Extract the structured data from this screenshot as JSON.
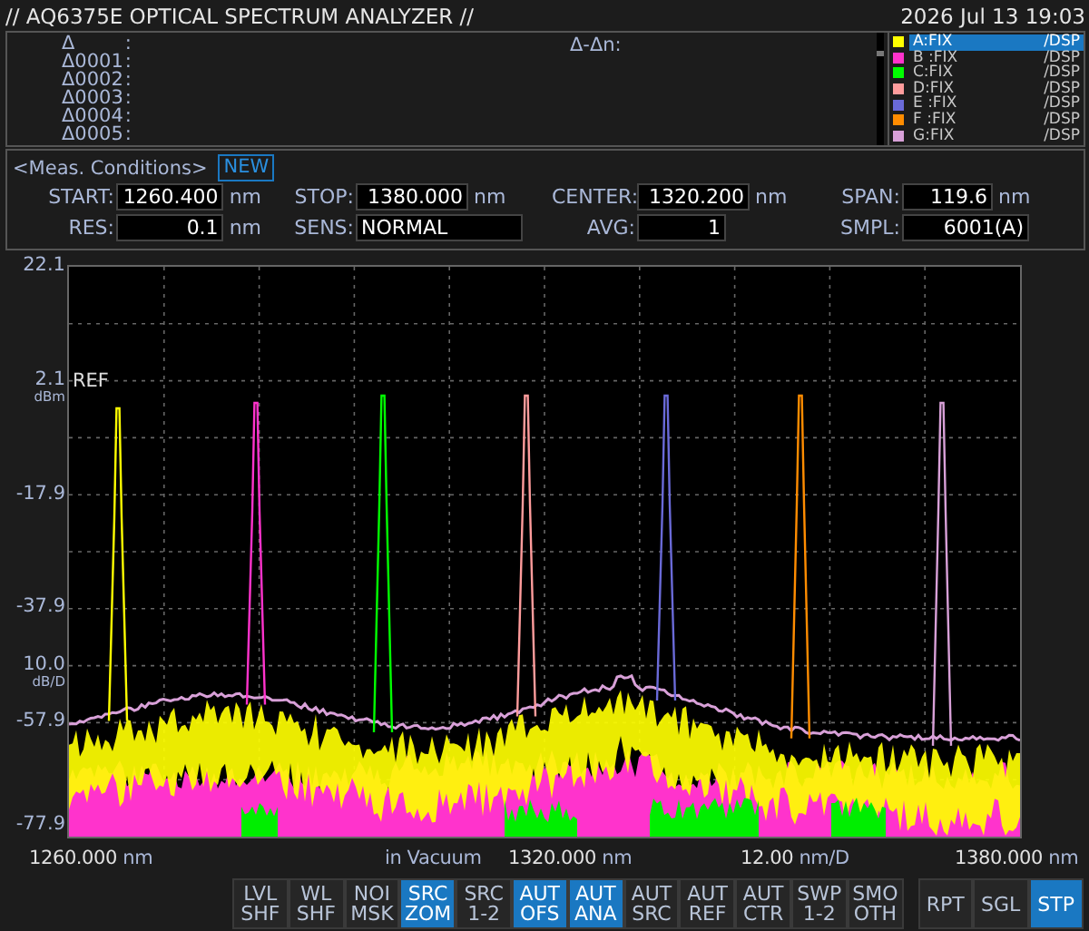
{
  "header": {
    "title": "// AQ6375E OPTICAL SPECTRUM ANALYZER //",
    "datetime": "2026 Jul 13 19:03"
  },
  "markers": {
    "rows": [
      {
        "name": "Δ",
        "sep": ":"
      },
      {
        "name": "Δ0001",
        "sep": ":"
      },
      {
        "name": "Δ0002",
        "sep": ":"
      },
      {
        "name": "Δ0003",
        "sep": ":"
      },
      {
        "name": "Δ0004",
        "sep": ":"
      },
      {
        "name": "Δ0005",
        "sep": ":"
      }
    ],
    "delta_label": "Δ-Δn:"
  },
  "traces": [
    {
      "label": "A:FIX",
      "mode": "/DSP",
      "color": "#ffff00",
      "selected": true
    },
    {
      "label": "B :FIX",
      "mode": "/DSP",
      "color": "#ff33cc",
      "selected": false
    },
    {
      "label": "C:FIX",
      "mode": "/DSP",
      "color": "#00ff00",
      "selected": false
    },
    {
      "label": "D:FIX",
      "mode": "/DSP",
      "color": "#ff9c9c",
      "selected": false
    },
    {
      "label": "E :FIX",
      "mode": "/DSP",
      "color": "#6a6ad8",
      "selected": false
    },
    {
      "label": "F :FIX",
      "mode": "/DSP",
      "color": "#ff8c00",
      "selected": false
    },
    {
      "label": "G:FIX",
      "mode": "/DSP",
      "color": "#d8a0d8",
      "selected": false
    }
  ],
  "conditions": {
    "title": "<Meas. Conditions>",
    "badge": "NEW",
    "fields": [
      {
        "label": "START:",
        "value": "1260.400",
        "unit": "nm"
      },
      {
        "label": "STOP:",
        "value": "1380.000",
        "unit": "nm"
      },
      {
        "label": "CENTER:",
        "value": "1320.200",
        "unit": "nm"
      },
      {
        "label": "SPAN:",
        "value": "119.6",
        "unit": "nm"
      },
      {
        "label": "RES:",
        "value": "0.1",
        "unit": "nm"
      },
      {
        "label": "SENS:",
        "value": "NORMAL"
      },
      {
        "label": "AVG:",
        "value": "1"
      },
      {
        "label": "SMPL:",
        "value": "6001(A)"
      }
    ]
  },
  "chart": {
    "y_labels": [
      {
        "value": "22.1"
      },
      {
        "value": "2.1",
        "unit": "dBm",
        "tag": "REF"
      },
      {
        "value": "-17.9"
      },
      {
        "value": "-37.9"
      },
      {
        "value": "10.0",
        "unit": "dB/D"
      },
      {
        "value": "-57.9"
      },
      {
        "value": "-77.9"
      }
    ],
    "x_labels": [
      {
        "value": "1260.000",
        "unit": "nm"
      },
      {
        "value": "in Vacuum"
      },
      {
        "value": "1320.000",
        "unit": "nm"
      },
      {
        "value": "12.00",
        "unit": "nm/D"
      },
      {
        "value": "1380.000",
        "unit": "nm"
      }
    ]
  },
  "softkeys": [
    {
      "top": "LVL",
      "bottom": "SHF",
      "selected": false
    },
    {
      "top": "WL",
      "bottom": "SHF",
      "selected": false
    },
    {
      "top": "NOI",
      "bottom": "MSK",
      "selected": false
    },
    {
      "top": "SRC",
      "bottom": "ZOM",
      "selected": true
    },
    {
      "top": "SRC",
      "bottom": "1-2",
      "selected": false
    },
    {
      "top": "AUT",
      "bottom": "OFS",
      "selected": true
    },
    {
      "top": "AUT",
      "bottom": "ANA",
      "selected": true
    },
    {
      "top": "AUT",
      "bottom": "SRC",
      "selected": false
    },
    {
      "top": "AUT",
      "bottom": "REF",
      "selected": false
    },
    {
      "top": "AUT",
      "bottom": "CTR",
      "selected": false
    },
    {
      "top": "SWP",
      "bottom": "1-2",
      "selected": false
    },
    {
      "top": "SMO",
      "bottom": "OTH",
      "selected": false
    }
  ],
  "sweep_keys": [
    {
      "label": "RPT",
      "selected": false
    },
    {
      "label": "SGL",
      "selected": false
    },
    {
      "label": "STP",
      "selected": true
    }
  ]
}
